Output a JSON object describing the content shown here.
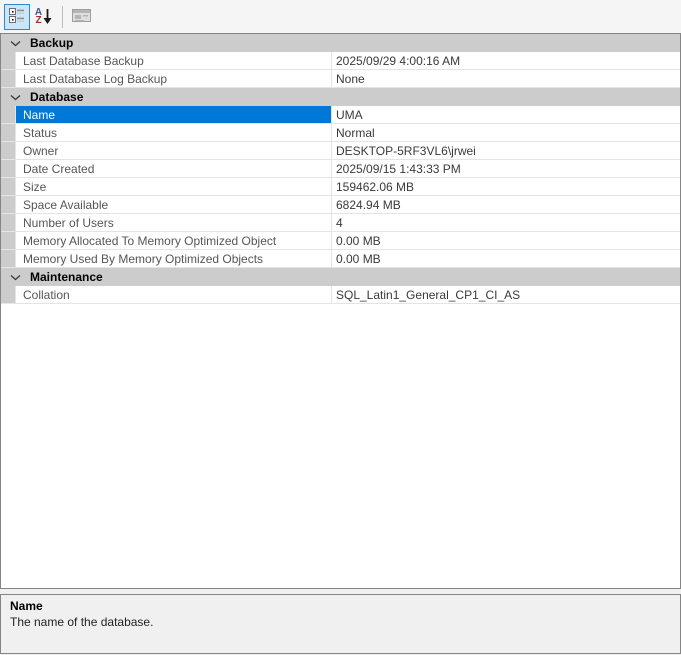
{
  "accent_colors": {
    "selection_blue": "#0078d7",
    "category_gray": "#cccccc",
    "toolbar_active_bg": "#cde6f7",
    "toolbar_active_border": "#2a8ad4"
  },
  "toolbar": {
    "icons": {
      "categorized": "categorized-view-icon",
      "alphabetical": "az-sort-descending-icon",
      "property_pages": "property-pages-icon"
    },
    "sort_letter_a": "A",
    "sort_letter_z": "Z",
    "categorized_active": true,
    "property_pages_disabled": true
  },
  "grid": {
    "sections": [
      {
        "label": "Backup",
        "rows": [
          {
            "name": "Last Database Backup",
            "value": "2025/09/29 4:00:16 AM"
          },
          {
            "name": "Last Database Log Backup",
            "value": "None"
          }
        ]
      },
      {
        "label": "Database",
        "rows": [
          {
            "name": "Name",
            "value": "UMA",
            "selected": true
          },
          {
            "name": "Status",
            "value": "Normal"
          },
          {
            "name": "Owner",
            "value": "DESKTOP-5RF3VL6\\jrwei"
          },
          {
            "name": "Date Created",
            "value": "2025/09/15 1:43:33 PM"
          },
          {
            "name": "Size",
            "value": "159462.06 MB"
          },
          {
            "name": "Space Available",
            "value": "6824.94 MB"
          },
          {
            "name": "Number of Users",
            "value": "4"
          },
          {
            "name": "Memory Allocated To Memory Optimized Object",
            "value": "0.00 MB"
          },
          {
            "name": "Memory Used By Memory Optimized Objects",
            "value": "0.00 MB"
          }
        ]
      },
      {
        "label": "Maintenance",
        "rows": [
          {
            "name": "Collation",
            "value": "SQL_Latin1_General_CP1_CI_AS"
          }
        ]
      }
    ]
  },
  "description": {
    "title": "Name",
    "text": "The name of the database."
  }
}
